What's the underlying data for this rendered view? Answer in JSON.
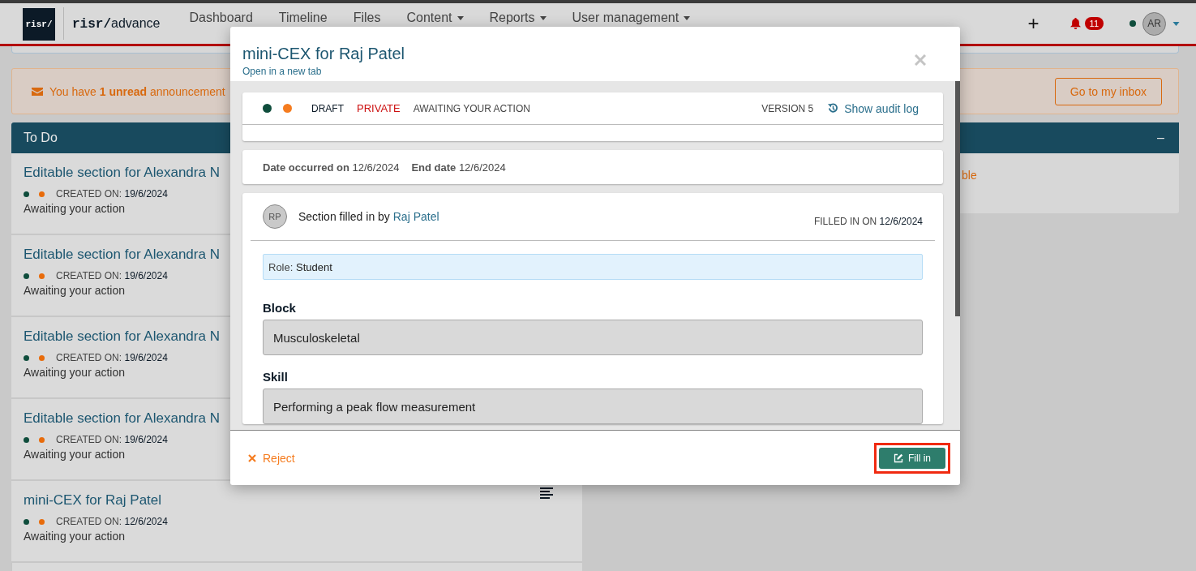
{
  "nav": {
    "logo": "risr/",
    "brand_prefix": "risr/",
    "brand_suffix": "advance",
    "items": [
      {
        "label": "Dashboard",
        "dropdown": false
      },
      {
        "label": "Timeline",
        "dropdown": false
      },
      {
        "label": "Files",
        "dropdown": false
      },
      {
        "label": "Content",
        "dropdown": true
      },
      {
        "label": "Reports",
        "dropdown": true
      },
      {
        "label": "User management",
        "dropdown": true
      }
    ],
    "add": "+",
    "notifications": "11",
    "avatar": "AR"
  },
  "announcement": {
    "text": "You have **1 unread** announcement",
    "button": "Go to my inbox"
  },
  "todo": {
    "title": "To Do",
    "items": [
      {
        "title": "Editable section for Alexandra N",
        "created_label": "CREATED ON:",
        "created_on": "19/6/2024",
        "status": "Awaiting your action",
        "dots": [
          {
            "color": "#0f4d3c"
          },
          {
            "color": "#e86b0a"
          }
        ]
      },
      {
        "title": "Editable section for Alexandra N",
        "created_label": "CREATED ON:",
        "created_on": "19/6/2024",
        "status": "Awaiting your action",
        "dots": [
          {
            "color": "#0f4d3c"
          },
          {
            "color": "#e86b0a"
          }
        ]
      },
      {
        "title": "Editable section for Alexandra N",
        "created_label": "CREATED ON:",
        "created_on": "19/6/2024",
        "status": "Awaiting your action",
        "dots": [
          {
            "color": "#0f4d3c"
          },
          {
            "color": "#e86b0a"
          }
        ]
      },
      {
        "title": "Editable section for Alexandra N",
        "created_label": "CREATED ON:",
        "created_on": "19/6/2024",
        "status": "Awaiting your action",
        "dots": [
          {
            "color": "#0f4d3c"
          },
          {
            "color": "#e86b0a"
          }
        ]
      },
      {
        "title": "mini-CEX for Raj Patel",
        "created_label": "CREATED ON:",
        "created_on": "12/6/2024",
        "status": "Awaiting your action",
        "dots": [
          {
            "color": "#0f4d3c"
          },
          {
            "color": "#e86b0a"
          }
        ],
        "list_icon": true
      }
    ]
  },
  "side_panel": {
    "collapse": "–",
    "text": "ble"
  },
  "modal": {
    "title": "mini-CEX for Raj Patel",
    "link": "Open in a new tab",
    "status": {
      "dots": [
        {
          "color": "#0f4d3c"
        },
        {
          "color": "#f57c1f"
        }
      ],
      "badges": [
        {
          "text": "DRAFT",
          "kind": "draft"
        },
        {
          "text": "PRIVATE",
          "kind": "private"
        },
        {
          "text": "AWAITING YOUR ACTION",
          "kind": "state"
        }
      ],
      "version": "VERSION 5",
      "audit": "Show audit log"
    },
    "dates": [
      {
        "label": "Date occurred on",
        "value": "12/6/2024"
      },
      {
        "label": "End date",
        "value": "12/6/2024"
      }
    ],
    "section": {
      "avatar": "RP",
      "filled_by": "Section filled in by",
      "author": "Raj Patel",
      "filled_label": "FILLED IN ON",
      "filled_date": "12/6/2024",
      "role_label": "Role:",
      "role": "Student",
      "fields": [
        {
          "label": "Block",
          "value": "Musculoskeletal"
        },
        {
          "label": "Skill",
          "value": "Performing a peak flow measurement"
        }
      ]
    },
    "reject": "Reject",
    "fill_in": "Fill in",
    "fill_in_highlighted": true
  }
}
